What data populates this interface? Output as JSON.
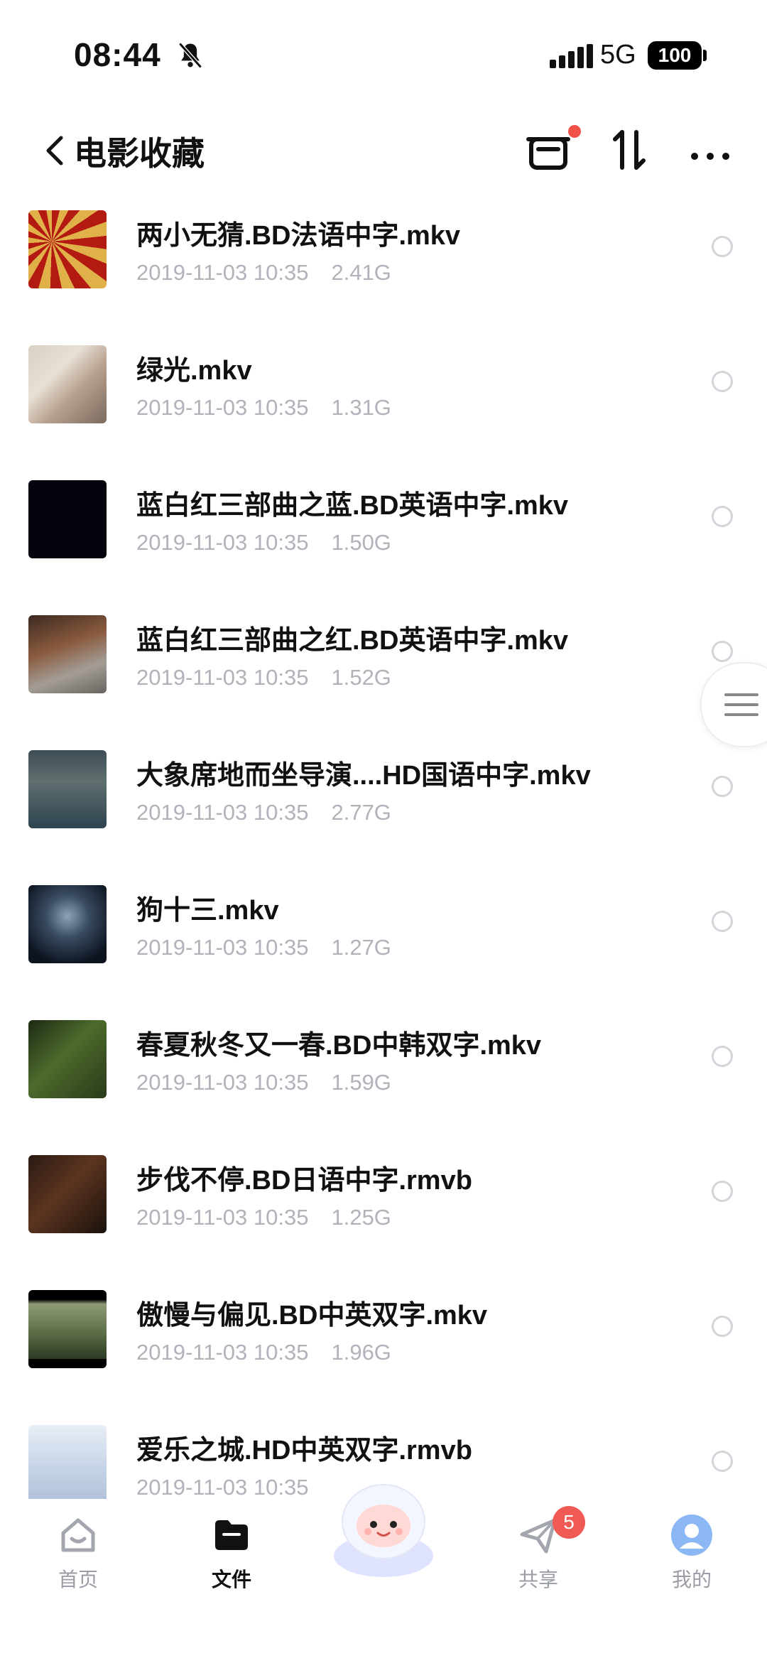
{
  "status_bar": {
    "time": "08:44",
    "network": "5G",
    "battery": "100"
  },
  "header": {
    "title": "电影收藏"
  },
  "files": [
    {
      "name": "两小无猜.BD法语中字.mkv",
      "date": "2019-11-03 10:35",
      "size": "2.41G"
    },
    {
      "name": "绿光.mkv",
      "date": "2019-11-03 10:35",
      "size": "1.31G"
    },
    {
      "name": "蓝白红三部曲之蓝.BD英语中字.mkv",
      "date": "2019-11-03 10:35",
      "size": "1.50G"
    },
    {
      "name": "蓝白红三部曲之红.BD英语中字.mkv",
      "date": "2019-11-03 10:35",
      "size": "1.52G"
    },
    {
      "name": "大象席地而坐导演....HD国语中字.mkv",
      "date": "2019-11-03 10:35",
      "size": "2.77G"
    },
    {
      "name": "狗十三.mkv",
      "date": "2019-11-03 10:35",
      "size": "1.27G"
    },
    {
      "name": "春夏秋冬又一春.BD中韩双字.mkv",
      "date": "2019-11-03 10:35",
      "size": "1.59G"
    },
    {
      "name": "步伐不停.BD日语中字.rmvb",
      "date": "2019-11-03 10:35",
      "size": "1.25G"
    },
    {
      "name": "傲慢与偏见.BD中英双字.mkv",
      "date": "2019-11-03 10:35",
      "size": "1.96G"
    },
    {
      "name": "爱乐之城.HD中英双字.rmvb",
      "date": "2019-11-03 10:35",
      "size": ""
    }
  ],
  "bottom_nav": {
    "home": "首页",
    "files": "文件",
    "share": "共享",
    "me": "我的",
    "share_badge": "5"
  },
  "colors": {
    "accent_red": "#f0524a",
    "meta_grey": "#b0b3ba"
  }
}
